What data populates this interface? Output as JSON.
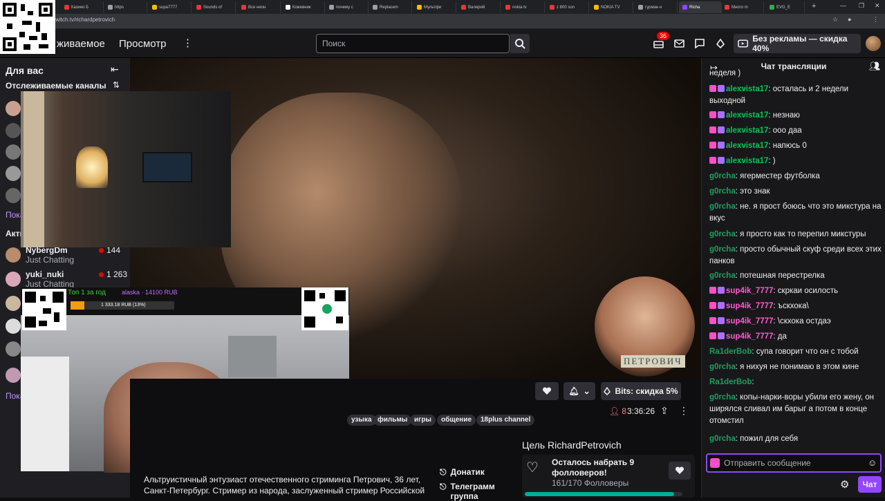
{
  "browser": {
    "tabs": [
      {
        "label": "Казино Б",
        "color": "#e53935"
      },
      {
        "label": "https",
        "color": "#9aa0a6"
      },
      {
        "label": "supa7777",
        "color": "#fbbc04"
      },
      {
        "label": "Sounds of",
        "color": "#e53935"
      },
      {
        "label": "Все неон",
        "color": "#e53935"
      },
      {
        "label": "Кожевник",
        "color": "#ffffff"
      },
      {
        "label": "почему с",
        "color": "#9aa0a6"
      },
      {
        "label": "Replacem",
        "color": "#9aa0a6"
      },
      {
        "label": "Мультфи",
        "color": "#fbbc04"
      },
      {
        "label": "Валерий",
        "color": "#e53935"
      },
      {
        "label": "nokia tv",
        "color": "#e53935"
      },
      {
        "label": "z 800 son",
        "color": "#e53935"
      },
      {
        "label": "NOKIA TV",
        "color": "#fbbc04"
      },
      {
        "label": "гурман н",
        "color": "#9aa0a6"
      },
      {
        "label": "Richa",
        "color": "#9147ff"
      },
      {
        "label": "Много m",
        "color": "#e53935"
      },
      {
        "label": "EVG_E",
        "color": "#34a853"
      }
    ],
    "url": "twitch.tv/richardpetrovich"
  },
  "nav": {
    "following": "живаемое",
    "browse": "Просмотр",
    "search_placeholder": "Поиск",
    "notifications_count": "36",
    "ad_free": "Без рекламы — скидка 40%"
  },
  "sidebar": {
    "for_you": "Для вас",
    "followed_title": "Отслеживаемые каналы",
    "show_more": "Пока",
    "active_title": "Акти",
    "channels": [
      {
        "name": "NybergDm",
        "game": "Just Chatting",
        "viewers": "144"
      },
      {
        "name": "yuki_nuki",
        "game": "Just Chatting",
        "viewers": "1 263"
      }
    ],
    "show_more2": "Пока"
  },
  "stream": {
    "cam_label": "ПЕТРОВИЧ",
    "overlay_top_line": "Топ 1 за год",
    "overlay_donor": "alaska · 14100 RUB",
    "overlay_goal": "1 333.18 RUB (13%)"
  },
  "info": {
    "bits_discount": "Bits: скидка 5%",
    "viewers": "8",
    "uptime": "3:36:26",
    "tags": [
      "узыка",
      "фильмы",
      "игры",
      "общение",
      "18plus channel"
    ],
    "donatik": "Донатик",
    "telegram": "Телеграмм",
    "telegram_sub": "группа",
    "description": "Альтруистичный энтузиаст отечественного стриминга Петрович, 36 лет, Санкт-Петербург. Стример из народа, заслуженный стример Российской",
    "goal_title": "Цель RichardPetrovich",
    "goal_text": "Осталось набрать 9 фолловеров!",
    "goal_progress": "161/170 Фолловеры",
    "goal_fraction": 0.947
  },
  "chat": {
    "title": "Чат трансляции",
    "messages": [
      {
        "user": "",
        "color": "#efeff1",
        "text": "неделя )",
        "badges": false
      },
      {
        "user": "alexvista17",
        "color": "#00c853",
        "text": ": осталась и 2 недели выходной",
        "badges": true
      },
      {
        "user": "alexvista17",
        "color": "#00c853",
        "text": ": незнаю",
        "badges": true
      },
      {
        "user": "alexvista17",
        "color": "#00c853",
        "text": ": ооо даа",
        "badges": true
      },
      {
        "user": "alexvista17",
        "color": "#00c853",
        "text": ": напюсь 0",
        "badges": true
      },
      {
        "user": "alexvista17",
        "color": "#00c853",
        "text": ": )",
        "badges": true
      },
      {
        "user": "g0rcha",
        "color": "#1e9e5e",
        "text": ": ягерместер футболка",
        "badges": false
      },
      {
        "user": "g0rcha",
        "color": "#1e9e5e",
        "text": ": это знак",
        "badges": false
      },
      {
        "user": "g0rcha",
        "color": "#1e9e5e",
        "text": ": не. я прост боюсь что это микстура на вкус",
        "badges": false
      },
      {
        "user": "g0rcha",
        "color": "#1e9e5e",
        "text": ": я просто как то перепил микстуры",
        "badges": false
      },
      {
        "user": "g0rcha",
        "color": "#1e9e5e",
        "text": ": просто обычный скуф среди всех этих панков",
        "badges": false
      },
      {
        "user": "g0rcha",
        "color": "#1e9e5e",
        "text": ": потешная перестрелка",
        "badges": false
      },
      {
        "user": "sup4ik_7777",
        "color": "#ff5ccd",
        "text": ": скркаи осилость",
        "badges": true
      },
      {
        "user": "sup4ik_7777",
        "color": "#ff5ccd",
        "text": ": ъскхока\\",
        "badges": true
      },
      {
        "user": "sup4ik_7777",
        "color": "#ff5ccd",
        "text": ": \\скхока остдаэ",
        "badges": true
      },
      {
        "user": "sup4ik_7777",
        "color": "#ff5ccd",
        "text": ": да",
        "badges": true
      },
      {
        "user": "Ra1derBob",
        "color": "#1e9e5e",
        "text": ": супа говорит что он с тобой",
        "badges": false
      },
      {
        "user": "g0rcha",
        "color": "#1e9e5e",
        "text": ": я нихуя не понимаю в этом кине",
        "badges": false
      },
      {
        "user": "Ra1derBob",
        "color": "#1e9e5e",
        "text": ":",
        "badges": false
      },
      {
        "user": "g0rcha",
        "color": "#1e9e5e",
        "text": ": копы-нарки-воры убили его жену, он ширялся сливал им барыг а потом в конце отомстил",
        "badges": false
      },
      {
        "user": "g0rcha",
        "color": "#1e9e5e",
        "text": ": пожил для себя",
        "badges": false
      }
    ],
    "input_placeholder": "Отправить сообщение",
    "send": "Чат"
  }
}
